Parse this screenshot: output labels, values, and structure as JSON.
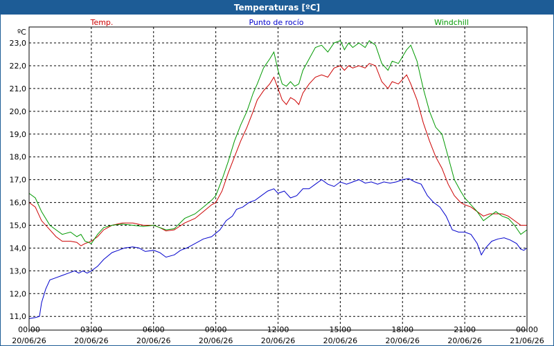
{
  "window": {
    "title": "Temperaturas [ºC]"
  },
  "chart_data": {
    "type": "line",
    "title": "Temperaturas [ºC]",
    "ylabel": "ºC",
    "ylim": [
      10.4,
      23.7
    ],
    "y_ticks": [
      11.0,
      12.0,
      13.0,
      14.0,
      15.0,
      16.0,
      17.0,
      18.0,
      19.0,
      20.0,
      21.0,
      22.0,
      23.0
    ],
    "x_range_hours": [
      0,
      24
    ],
    "x_ticks": [
      {
        "hour": 0,
        "time": "00:00",
        "date": "20/06/26"
      },
      {
        "hour": 3,
        "time": "03:00",
        "date": "20/06/26"
      },
      {
        "hour": 6,
        "time": "06:00",
        "date": "20/06/26"
      },
      {
        "hour": 9,
        "time": "09:00",
        "date": "20/06/26"
      },
      {
        "hour": 12,
        "time": "12:00",
        "date": "20/06/26"
      },
      {
        "hour": 15,
        "time": "15:00",
        "date": "20/06/26"
      },
      {
        "hour": 18,
        "time": "18:00",
        "date": "20/06/26"
      },
      {
        "hour": 21,
        "time": "21:00",
        "date": "20/06/26"
      },
      {
        "hour": 24,
        "time": "00:00",
        "date": "21/06/26"
      }
    ],
    "grid": true,
    "legend_position": "top",
    "series": [
      {
        "name": "Temp.",
        "color": "#cc0000",
        "points": [
          [
            0,
            16.0
          ],
          [
            0.3,
            15.8
          ],
          [
            0.6,
            15.2
          ],
          [
            1.0,
            14.8
          ],
          [
            1.3,
            14.5
          ],
          [
            1.6,
            14.3
          ],
          [
            2.0,
            14.3
          ],
          [
            2.3,
            14.25
          ],
          [
            2.5,
            14.1
          ],
          [
            2.7,
            14.2
          ],
          [
            3.0,
            14.3
          ],
          [
            3.3,
            14.5
          ],
          [
            3.6,
            14.8
          ],
          [
            4.0,
            15.0
          ],
          [
            4.5,
            15.1
          ],
          [
            5.0,
            15.1
          ],
          [
            5.5,
            15.0
          ],
          [
            6.0,
            15.0
          ],
          [
            6.3,
            14.9
          ],
          [
            6.6,
            14.75
          ],
          [
            7.0,
            14.8
          ],
          [
            7.5,
            15.1
          ],
          [
            8.0,
            15.3
          ],
          [
            8.4,
            15.6
          ],
          [
            8.8,
            15.9
          ],
          [
            9.0,
            16.0
          ],
          [
            9.3,
            16.5
          ],
          [
            9.6,
            17.3
          ],
          [
            9.9,
            18.0
          ],
          [
            10.2,
            18.7
          ],
          [
            10.5,
            19.3
          ],
          [
            10.8,
            20.0
          ],
          [
            11.0,
            20.5
          ],
          [
            11.3,
            20.9
          ],
          [
            11.6,
            21.2
          ],
          [
            11.8,
            21.5
          ],
          [
            12.0,
            21.0
          ],
          [
            12.2,
            20.5
          ],
          [
            12.4,
            20.3
          ],
          [
            12.6,
            20.6
          ],
          [
            12.8,
            20.5
          ],
          [
            13.0,
            20.3
          ],
          [
            13.2,
            20.8
          ],
          [
            13.5,
            21.2
          ],
          [
            13.8,
            21.5
          ],
          [
            14.1,
            21.6
          ],
          [
            14.4,
            21.5
          ],
          [
            14.7,
            21.9
          ],
          [
            15.0,
            22.0
          ],
          [
            15.2,
            21.8
          ],
          [
            15.4,
            22.0
          ],
          [
            15.6,
            21.9
          ],
          [
            15.9,
            22.0
          ],
          [
            16.2,
            21.9
          ],
          [
            16.4,
            22.1
          ],
          [
            16.7,
            22.0
          ],
          [
            17.0,
            21.3
          ],
          [
            17.3,
            21.0
          ],
          [
            17.5,
            21.3
          ],
          [
            17.8,
            21.2
          ],
          [
            18.0,
            21.4
          ],
          [
            18.2,
            21.6
          ],
          [
            18.4,
            21.2
          ],
          [
            18.7,
            20.5
          ],
          [
            19.0,
            19.5
          ],
          [
            19.3,
            18.7
          ],
          [
            19.6,
            18.0
          ],
          [
            19.9,
            17.5
          ],
          [
            20.2,
            16.8
          ],
          [
            20.5,
            16.3
          ],
          [
            20.8,
            16.0
          ],
          [
            21.0,
            15.9
          ],
          [
            21.3,
            15.8
          ],
          [
            21.6,
            15.6
          ],
          [
            21.9,
            15.4
          ],
          [
            22.2,
            15.5
          ],
          [
            22.5,
            15.5
          ],
          [
            22.8,
            15.5
          ],
          [
            23.1,
            15.4
          ],
          [
            23.4,
            15.2
          ],
          [
            23.7,
            15.0
          ],
          [
            24.0,
            15.0
          ]
        ]
      },
      {
        "name": "Punto de rocío",
        "color": "#0000cc",
        "points": [
          [
            0,
            10.9
          ],
          [
            0.3,
            10.95
          ],
          [
            0.5,
            11.0
          ],
          [
            0.6,
            11.6
          ],
          [
            0.8,
            12.2
          ],
          [
            1.0,
            12.6
          ],
          [
            1.3,
            12.7
          ],
          [
            1.6,
            12.8
          ],
          [
            1.9,
            12.9
          ],
          [
            2.2,
            13.0
          ],
          [
            2.4,
            12.9
          ],
          [
            2.6,
            13.0
          ],
          [
            2.8,
            12.9
          ],
          [
            3.0,
            13.0
          ],
          [
            3.3,
            13.2
          ],
          [
            3.6,
            13.5
          ],
          [
            4.0,
            13.8
          ],
          [
            4.3,
            13.9
          ],
          [
            4.6,
            14.0
          ],
          [
            5.0,
            14.05
          ],
          [
            5.3,
            14.0
          ],
          [
            5.6,
            13.85
          ],
          [
            6.0,
            13.9
          ],
          [
            6.3,
            13.8
          ],
          [
            6.6,
            13.6
          ],
          [
            7.0,
            13.7
          ],
          [
            7.3,
            13.9
          ],
          [
            7.6,
            14.0
          ],
          [
            8.0,
            14.2
          ],
          [
            8.4,
            14.4
          ],
          [
            8.8,
            14.5
          ],
          [
            9.2,
            14.8
          ],
          [
            9.5,
            15.2
          ],
          [
            9.8,
            15.4
          ],
          [
            10.0,
            15.7
          ],
          [
            10.3,
            15.8
          ],
          [
            10.6,
            16.0
          ],
          [
            10.9,
            16.1
          ],
          [
            11.2,
            16.3
          ],
          [
            11.5,
            16.5
          ],
          [
            11.8,
            16.6
          ],
          [
            12.0,
            16.4
          ],
          [
            12.3,
            16.5
          ],
          [
            12.6,
            16.2
          ],
          [
            12.9,
            16.3
          ],
          [
            13.2,
            16.6
          ],
          [
            13.5,
            16.6
          ],
          [
            13.8,
            16.8
          ],
          [
            14.1,
            17.0
          ],
          [
            14.4,
            16.8
          ],
          [
            14.7,
            16.7
          ],
          [
            15.0,
            16.9
          ],
          [
            15.3,
            16.8
          ],
          [
            15.6,
            16.9
          ],
          [
            15.9,
            17.0
          ],
          [
            16.2,
            16.85
          ],
          [
            16.5,
            16.9
          ],
          [
            16.8,
            16.8
          ],
          [
            17.1,
            16.9
          ],
          [
            17.4,
            16.85
          ],
          [
            17.7,
            16.9
          ],
          [
            18.0,
            17.0
          ],
          [
            18.3,
            17.05
          ],
          [
            18.6,
            16.9
          ],
          [
            18.9,
            16.8
          ],
          [
            19.2,
            16.3
          ],
          [
            19.5,
            16.0
          ],
          [
            19.8,
            15.8
          ],
          [
            20.1,
            15.4
          ],
          [
            20.4,
            14.8
          ],
          [
            20.7,
            14.7
          ],
          [
            21.0,
            14.7
          ],
          [
            21.3,
            14.6
          ],
          [
            21.6,
            14.2
          ],
          [
            21.8,
            13.7
          ],
          [
            22.0,
            14.0
          ],
          [
            22.3,
            14.3
          ],
          [
            22.6,
            14.4
          ],
          [
            22.9,
            14.45
          ],
          [
            23.2,
            14.35
          ],
          [
            23.5,
            14.2
          ],
          [
            23.7,
            13.95
          ],
          [
            23.85,
            13.9
          ],
          [
            24.0,
            14.0
          ]
        ]
      },
      {
        "name": "Windchill",
        "color": "#009900",
        "points": [
          [
            0,
            16.4
          ],
          [
            0.3,
            16.2
          ],
          [
            0.6,
            15.6
          ],
          [
            1.0,
            15.0
          ],
          [
            1.3,
            14.8
          ],
          [
            1.6,
            14.6
          ],
          [
            2.0,
            14.7
          ],
          [
            2.3,
            14.5
          ],
          [
            2.5,
            14.6
          ],
          [
            2.7,
            14.3
          ],
          [
            3.0,
            14.2
          ],
          [
            3.3,
            14.6
          ],
          [
            3.6,
            14.9
          ],
          [
            4.0,
            15.0
          ],
          [
            4.5,
            15.05
          ],
          [
            5.0,
            15.0
          ],
          [
            5.5,
            14.95
          ],
          [
            6.0,
            15.0
          ],
          [
            6.3,
            14.9
          ],
          [
            6.6,
            14.8
          ],
          [
            7.0,
            14.85
          ],
          [
            7.5,
            15.3
          ],
          [
            8.0,
            15.5
          ],
          [
            8.4,
            15.8
          ],
          [
            8.8,
            16.1
          ],
          [
            9.0,
            16.3
          ],
          [
            9.3,
            17.0
          ],
          [
            9.6,
            17.8
          ],
          [
            9.9,
            18.7
          ],
          [
            10.2,
            19.4
          ],
          [
            10.5,
            20.0
          ],
          [
            10.8,
            20.8
          ],
          [
            11.0,
            21.2
          ],
          [
            11.3,
            21.9
          ],
          [
            11.6,
            22.3
          ],
          [
            11.8,
            22.6
          ],
          [
            12.0,
            21.8
          ],
          [
            12.2,
            21.2
          ],
          [
            12.4,
            21.1
          ],
          [
            12.6,
            21.3
          ],
          [
            12.8,
            21.1
          ],
          [
            13.0,
            21.2
          ],
          [
            13.2,
            21.8
          ],
          [
            13.5,
            22.3
          ],
          [
            13.8,
            22.8
          ],
          [
            14.1,
            22.9
          ],
          [
            14.4,
            22.6
          ],
          [
            14.7,
            23.0
          ],
          [
            15.0,
            23.1
          ],
          [
            15.2,
            22.7
          ],
          [
            15.4,
            23.0
          ],
          [
            15.6,
            22.8
          ],
          [
            15.9,
            23.0
          ],
          [
            16.2,
            22.8
          ],
          [
            16.4,
            23.1
          ],
          [
            16.7,
            22.9
          ],
          [
            17.0,
            22.1
          ],
          [
            17.3,
            21.8
          ],
          [
            17.5,
            22.2
          ],
          [
            17.8,
            22.1
          ],
          [
            18.0,
            22.4
          ],
          [
            18.2,
            22.7
          ],
          [
            18.4,
            22.9
          ],
          [
            18.7,
            22.2
          ],
          [
            19.0,
            21.0
          ],
          [
            19.3,
            20.0
          ],
          [
            19.6,
            19.3
          ],
          [
            19.9,
            19.0
          ],
          [
            20.2,
            18.0
          ],
          [
            20.5,
            17.0
          ],
          [
            20.8,
            16.5
          ],
          [
            21.0,
            16.2
          ],
          [
            21.3,
            15.9
          ],
          [
            21.6,
            15.6
          ],
          [
            21.9,
            15.2
          ],
          [
            22.2,
            15.4
          ],
          [
            22.5,
            15.6
          ],
          [
            22.8,
            15.4
          ],
          [
            23.1,
            15.3
          ],
          [
            23.4,
            15.0
          ],
          [
            23.7,
            14.6
          ],
          [
            24.0,
            14.8
          ]
        ]
      }
    ]
  }
}
